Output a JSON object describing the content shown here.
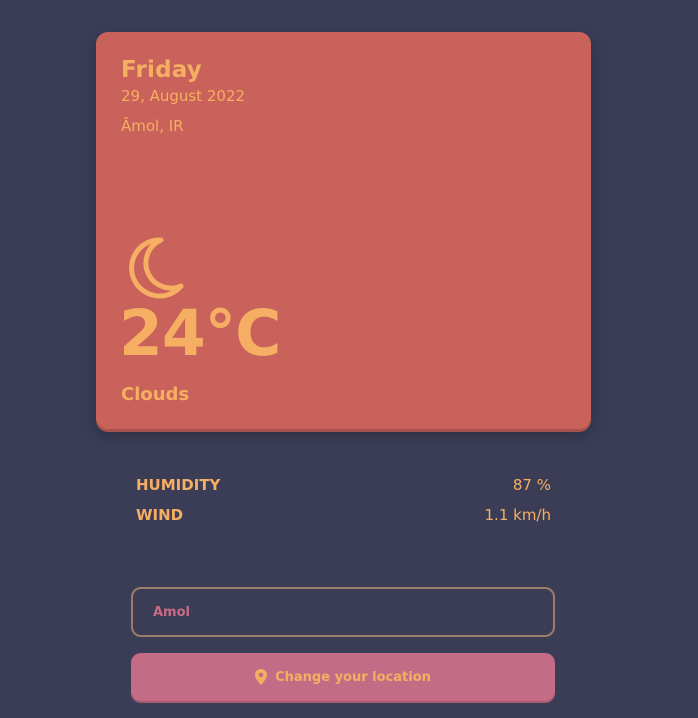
{
  "weather": {
    "day": "Friday",
    "date": "29, August 2022",
    "location": "Āmol, IR",
    "icon": "moon-icon",
    "temperature": "24°C",
    "condition": "Clouds"
  },
  "stats": [
    {
      "label": "HUMIDITY",
      "value": "87 %"
    },
    {
      "label": "WIND",
      "value": "1.1 km/h"
    }
  ],
  "search": {
    "value": "Amol"
  },
  "button": {
    "label": "Change your location",
    "icon": "location-pin-icon"
  },
  "colors": {
    "background": "#3b3d57",
    "card": "#c9625b",
    "accent": "#f6ae62",
    "button": "#c46b86"
  }
}
